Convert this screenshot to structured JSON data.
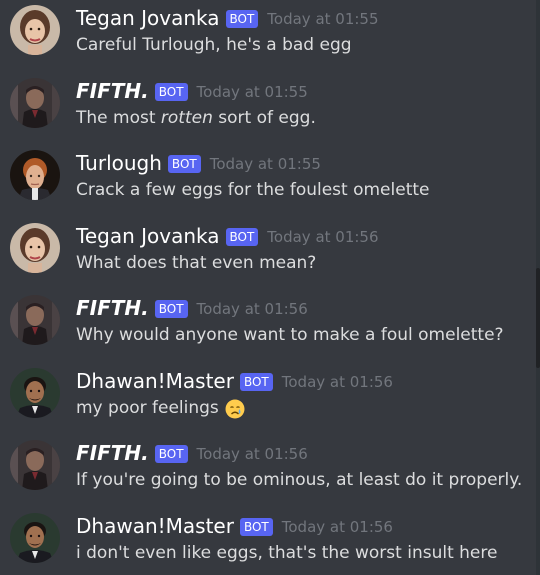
{
  "messages": [
    {
      "username": "Tegan Jovanka",
      "bot_label": "BOT",
      "timestamp": "Today at 01:55",
      "text": "Careful Turlough, he's a bad egg",
      "avatar": "tegan-avatar"
    },
    {
      "username": "FIFTH.",
      "bot_label": "BOT",
      "timestamp": "Today at 01:55",
      "text_before": "The most ",
      "text_italic": "rotten",
      "text_after": " sort of egg.",
      "avatar": "fifth-avatar"
    },
    {
      "username": "Turlough",
      "bot_label": "BOT",
      "timestamp": "Today at 01:55",
      "text": "Crack a few eggs for the foulest omelette",
      "avatar": "turlough-avatar"
    },
    {
      "username": "Tegan Jovanka",
      "bot_label": "BOT",
      "timestamp": "Today at 01:56",
      "text": "What does that even mean?",
      "avatar": "tegan-avatar"
    },
    {
      "username": "FIFTH.",
      "bot_label": "BOT",
      "timestamp": "Today at 01:56",
      "text": "Why would anyone want to make a foul omelette?",
      "avatar": "fifth-avatar"
    },
    {
      "username": "Dhawan!Master",
      "bot_label": "BOT",
      "timestamp": "Today at 01:56",
      "text": "my poor feelings",
      "emoji": "crying-face-emoji",
      "avatar": "dhawan-avatar"
    },
    {
      "username": "FIFTH.",
      "bot_label": "BOT",
      "timestamp": "Today at 01:56",
      "text": "If you're going to be ominous, at least do it properly.",
      "avatar": "fifth-avatar"
    },
    {
      "username": "Dhawan!Master",
      "bot_label": "BOT",
      "timestamp": "Today at 01:56",
      "text": "i don't even like eggs, that's the worst insult here",
      "avatar": "dhawan-avatar"
    }
  ],
  "colors": {
    "background": "#36393f",
    "bot_tag": "#5865f2",
    "timestamp": "#72767d",
    "message_text": "#dcddde",
    "username": "#ffffff"
  }
}
